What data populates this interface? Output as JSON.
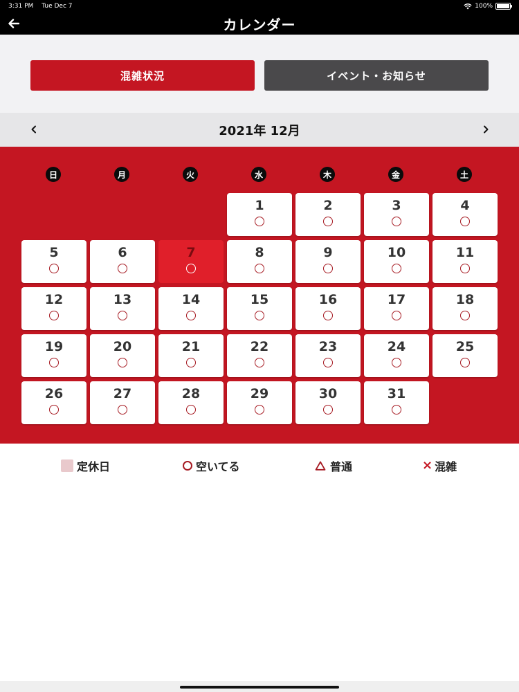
{
  "status_bar": {
    "time": "3:31 PM",
    "date": "Tue Dec 7",
    "battery": "100%",
    "battery_level": 1.0,
    "wifi_icon": "wifi-icon"
  },
  "nav": {
    "title": "カレンダー",
    "back_icon": "arrow-left-icon"
  },
  "tabs": [
    {
      "label": "混雑状況",
      "active": true,
      "color": "#c41622"
    },
    {
      "label": "イベント・お知らせ",
      "active": false,
      "color": "#4a494b"
    }
  ],
  "calendar": {
    "month_label": "2021年 12月",
    "prev_icon": "chevron-left-icon",
    "next_icon": "chevron-right-icon",
    "weekdays": [
      "日",
      "月",
      "火",
      "水",
      "木",
      "金",
      "土"
    ],
    "first_weekday_index": 3,
    "today": "7",
    "days": [
      {
        "day": "1",
        "status": "○"
      },
      {
        "day": "2",
        "status": "○"
      },
      {
        "day": "3",
        "status": "○"
      },
      {
        "day": "4",
        "status": "○"
      },
      {
        "day": "5",
        "status": "○"
      },
      {
        "day": "6",
        "status": "○"
      },
      {
        "day": "7",
        "status": "○"
      },
      {
        "day": "8",
        "status": "○"
      },
      {
        "day": "9",
        "status": "○"
      },
      {
        "day": "10",
        "status": "○"
      },
      {
        "day": "11",
        "status": "○"
      },
      {
        "day": "12",
        "status": "○"
      },
      {
        "day": "13",
        "status": "○"
      },
      {
        "day": "14",
        "status": "○"
      },
      {
        "day": "15",
        "status": "○"
      },
      {
        "day": "16",
        "status": "○"
      },
      {
        "day": "17",
        "status": "○"
      },
      {
        "day": "18",
        "status": "○"
      },
      {
        "day": "19",
        "status": "○"
      },
      {
        "day": "20",
        "status": "○"
      },
      {
        "day": "21",
        "status": "○"
      },
      {
        "day": "22",
        "status": "○"
      },
      {
        "day": "23",
        "status": "○"
      },
      {
        "day": "24",
        "status": "○"
      },
      {
        "day": "25",
        "status": "○"
      },
      {
        "day": "26",
        "status": "○"
      },
      {
        "day": "27",
        "status": "○"
      },
      {
        "day": "28",
        "status": "○"
      },
      {
        "day": "29",
        "status": "○"
      },
      {
        "day": "30",
        "status": "○"
      },
      {
        "day": "31",
        "status": "○"
      }
    ]
  },
  "legend": {
    "closed": "定休日",
    "available": "空いてる",
    "normal": "普通",
    "crowded": "混雑",
    "crowded_mark": "×"
  },
  "colors": {
    "accent_red": "#c41622",
    "today_red": "#e01f2a",
    "dark_tab": "#4a494b",
    "closed_swatch": "#e9c9cc"
  }
}
